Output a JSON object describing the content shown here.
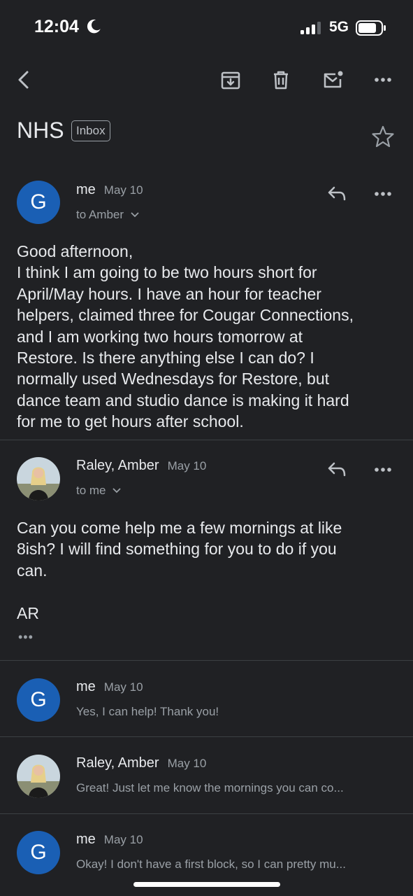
{
  "status_bar": {
    "time": "12:04",
    "network": "5G"
  },
  "toolbar": {
    "back_icon": "chevron-left-icon",
    "archive_icon": "archive-icon",
    "delete_icon": "trash-icon",
    "mark_unread_icon": "mail-unread-icon",
    "more_icon": "more-horizontal-icon"
  },
  "thread": {
    "subject": "NHS",
    "label": "Inbox"
  },
  "messages": [
    {
      "sender": "me",
      "date": "May 10",
      "avatar_letter": "G",
      "recipients": "to Amber",
      "body": [
        "Good afternoon,",
        "I think I am going to be two hours short for",
        "April/May hours. I have an hour for teacher",
        "helpers, claimed three for Cougar Connections,",
        "and I am working two hours tomorrow at",
        "Restore. Is there anything else I can do? I",
        "normally used Wednesdays for Restore, but",
        "dance team and studio dance is making it hard",
        "for me to get hours after school."
      ]
    },
    {
      "sender": "Raley, Amber",
      "date": "May 10",
      "recipients": "to me",
      "body": [
        "Can you come help me a few mornings at like",
        "8ish? I will find something for you to do if you",
        "can.",
        "",
        "AR"
      ],
      "quoted_toggle": "•••"
    },
    {
      "sender": "me",
      "date": "May 10",
      "avatar_letter": "G",
      "snippet": "Yes, I can help! Thank you!"
    },
    {
      "sender": "Raley, Amber",
      "date": "May 10",
      "snippet": "Great! Just let me know the mornings you can co..."
    },
    {
      "sender": "me",
      "date": "May 10",
      "avatar_letter": "G",
      "snippet": "Okay! I don't have a first block, so I can pretty mu..."
    }
  ],
  "colors": {
    "background": "#202124",
    "avatar_blue": "#1a5fb4",
    "divider": "#3c4043",
    "secondary_text": "#9aa0a6"
  }
}
